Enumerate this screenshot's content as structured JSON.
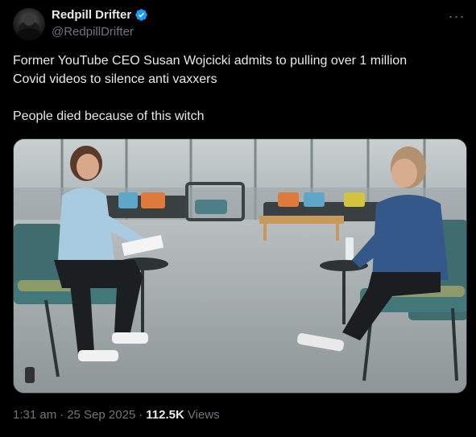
{
  "author": {
    "display_name": "Redpill Drifter",
    "handle": "@RedpillDrifter",
    "verified": true,
    "verified_color": "#1d9bf0"
  },
  "post": {
    "line1": "Former YouTube CEO Susan Wojcicki admits to pulling over 1 million",
    "line2": "Covid videos to silence anti vaxxers",
    "line3": "People died because of this witch"
  },
  "meta": {
    "time": "1:31 am",
    "separator": "·",
    "date": "25 Sep 2025",
    "views_count": "112.5K",
    "views_label": "Views"
  },
  "icons": {
    "more": "more-options-icon",
    "verified": "verified-badge-icon"
  },
  "colors": {
    "background": "#000000",
    "text": "#e7e9ea",
    "secondary": "#71767b"
  }
}
